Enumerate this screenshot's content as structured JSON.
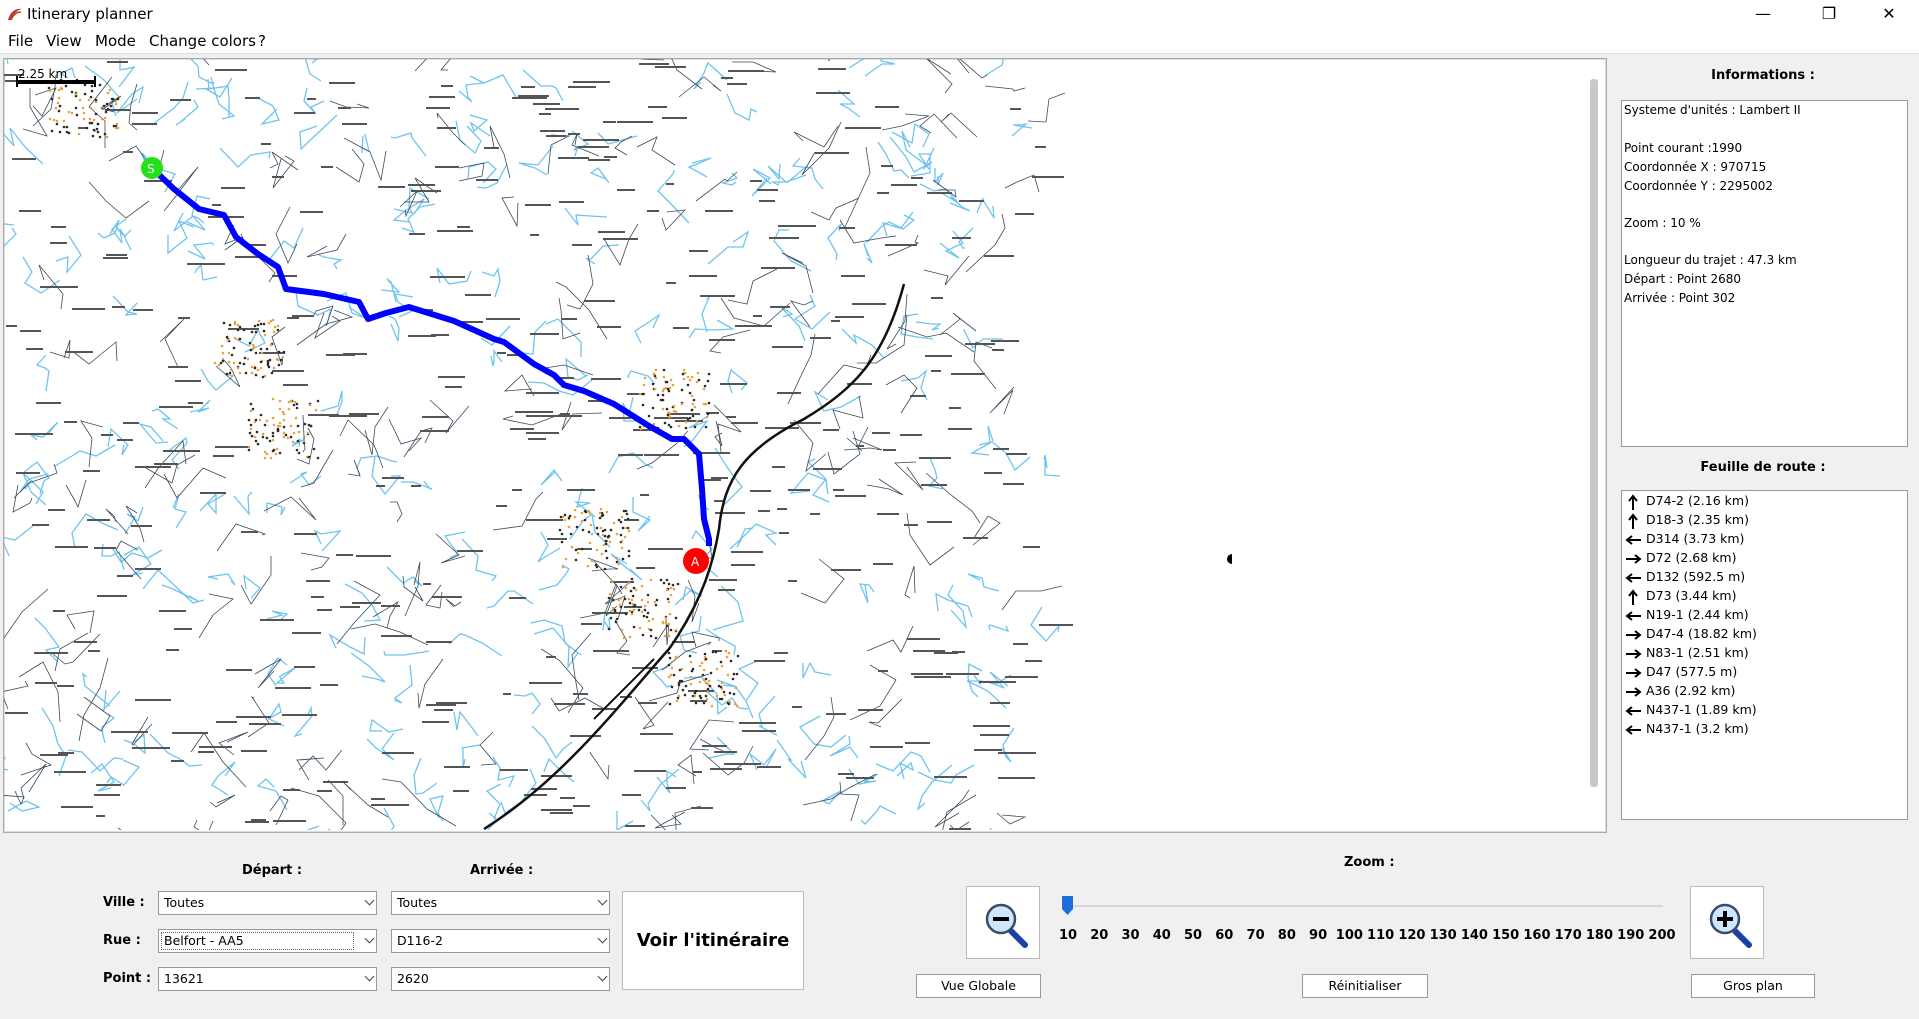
{
  "window": {
    "title": "Itinerary planner",
    "minimize_label": "—",
    "restore_label": "❐",
    "close_label": "✕"
  },
  "menu": [
    "File",
    "View",
    "Mode",
    "Change colors",
    "?"
  ],
  "map": {
    "scale_label": "2.25 km",
    "start_marker_label": "S",
    "end_marker_label": "A",
    "route_color": "#0000ff",
    "start_color": "#22e01a",
    "end_color": "#ff0000"
  },
  "info": {
    "title": "Informations :",
    "lines": [
      "Systeme d'unités : Lambert II",
      "",
      "Point courant :1990",
      "Coordonnée X : 970715",
      "Coordonnée Y : 2295002",
      "",
      "Zoom : 10 %",
      "",
      "Longueur du trajet : 47.3 km",
      "Départ : Point 2680",
      "Arrivée : Point 302"
    ]
  },
  "route_sheet": {
    "title": "Feuille de route :",
    "items": [
      {
        "dir": "up",
        "text": "D74-2 (2.16 km)"
      },
      {
        "dir": "up",
        "text": "D18-3 (2.35 km)"
      },
      {
        "dir": "left",
        "text": "D314 (3.73 km)"
      },
      {
        "dir": "right",
        "text": "D72 (2.68 km)"
      },
      {
        "dir": "left",
        "text": "D132 (592.5 m)"
      },
      {
        "dir": "up",
        "text": "D73 (3.44 km)"
      },
      {
        "dir": "left",
        "text": "N19-1 (2.44 km)"
      },
      {
        "dir": "right",
        "text": "D47-4 (18.82 km)"
      },
      {
        "dir": "right",
        "text": "N83-1 (2.51 km)"
      },
      {
        "dir": "right",
        "text": "D47 (577.5 m)"
      },
      {
        "dir": "right",
        "text": "A36 (2.92 km)"
      },
      {
        "dir": "left",
        "text": "N437-1 (1.89 km)"
      },
      {
        "dir": "left",
        "text": "N437-1 (3.2 km)"
      }
    ]
  },
  "depart": {
    "title": "Départ :",
    "ville": "Toutes",
    "rue": "Belfort - AA5",
    "point": "13621"
  },
  "arrivee": {
    "title": "Arrivée :",
    "ville": "Toutes",
    "rue": "D116-2",
    "point": "2620"
  },
  "labels": {
    "ville": "Ville :",
    "rue": "Rue :",
    "point": "Point :"
  },
  "show_route_button": "Voir l'itinéraire",
  "zoom": {
    "title": "Zoom :",
    "value": 10,
    "ticks": [
      "10",
      "20",
      "30",
      "40",
      "50",
      "60",
      "70",
      "80",
      "90",
      "100",
      "110",
      "120",
      "130",
      "140",
      "150",
      "160",
      "170",
      "180",
      "190",
      "200"
    ],
    "overview_button": "Vue Globale",
    "reset_button": "Réinitialiser",
    "closeup_button": "Gros plan"
  }
}
